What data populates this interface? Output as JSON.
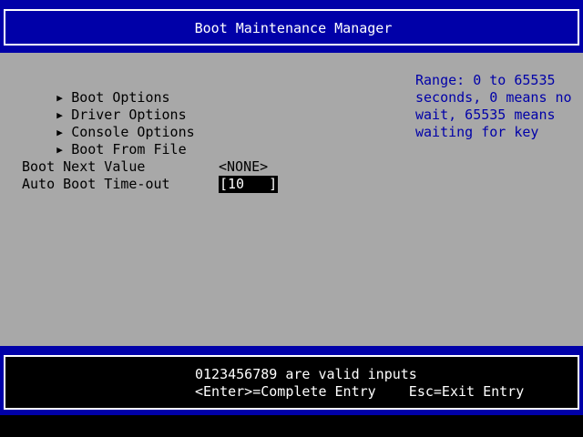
{
  "header": {
    "title": "Boot Maintenance Manager"
  },
  "menu": {
    "items": [
      {
        "label": "Boot Options"
      },
      {
        "label": "Driver Options"
      },
      {
        "label": "Console Options"
      },
      {
        "label": "Boot From File"
      }
    ],
    "arrow_glyph": "▶"
  },
  "fields": {
    "boot_next": {
      "label": "Boot Next Value",
      "value": "<NONE>"
    },
    "auto_boot": {
      "label": "Auto Boot Time-out",
      "value": "[10   ]"
    }
  },
  "help": {
    "lines": [
      "Range: 0 to 65535",
      "seconds, 0 means no",
      "wait, 65535 means",
      "waiting for key"
    ]
  },
  "footer": {
    "line1": "0123456789 are valid inputs",
    "line2": "<Enter>=Complete Entry    Esc=Exit Entry"
  },
  "colors": {
    "background": "#a8a8a8",
    "blue": "#0000a8",
    "white": "#ffffff",
    "black": "#000000"
  }
}
